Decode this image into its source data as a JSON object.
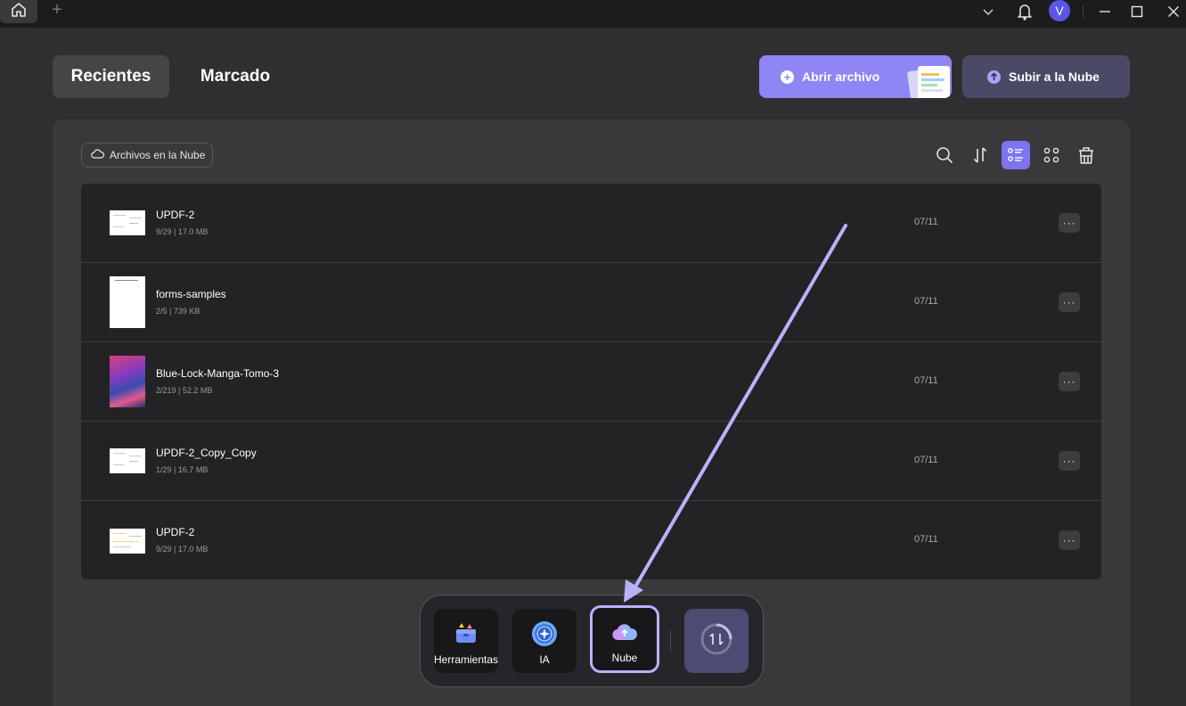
{
  "titlebar": {
    "home_icon": "home-icon",
    "new_tab_label": "+",
    "avatar_letter": "V",
    "dropdown_icon": "chevron-down-icon",
    "bell_icon": "bell-icon",
    "minimize_icon": "minimize-icon",
    "maximize_icon": "maximize-icon",
    "close_icon": "close-icon"
  },
  "tabs": {
    "recientes": "Recientes",
    "marcado": "Marcado"
  },
  "actions": {
    "open_file": "Abrir archivo",
    "upload_cloud": "Subir a la Nube"
  },
  "toolbar": {
    "cloud_filter": "Archivos en la Nube",
    "icons": [
      "search-icon",
      "sort-icon",
      "list-view-icon",
      "grid-view-icon",
      "trash-icon"
    ]
  },
  "files": [
    {
      "name": "UPDF-2",
      "meta": "9/29 | 17.0 MB",
      "date": "07/11"
    },
    {
      "name": "forms-samples",
      "meta": "2/5 | 739 KB",
      "date": "07/11"
    },
    {
      "name": "Blue-Lock-Manga-Tomo-3",
      "meta": "2/219 | 52.2 MB",
      "date": "07/11"
    },
    {
      "name": "UPDF-2_Copy_Copy",
      "meta": "1/29 | 16.7 MB",
      "date": "07/11"
    },
    {
      "name": "UPDF-2",
      "meta": "9/29 | 17.0 MB",
      "date": "07/11"
    }
  ],
  "more_label": "···",
  "dock": {
    "herramientas": "Herramientas",
    "ia": "IA",
    "nube": "Nube"
  },
  "colors": {
    "accent": "#8e86f5",
    "highlight": "#b9b2fb",
    "background": "#2f2f31"
  }
}
